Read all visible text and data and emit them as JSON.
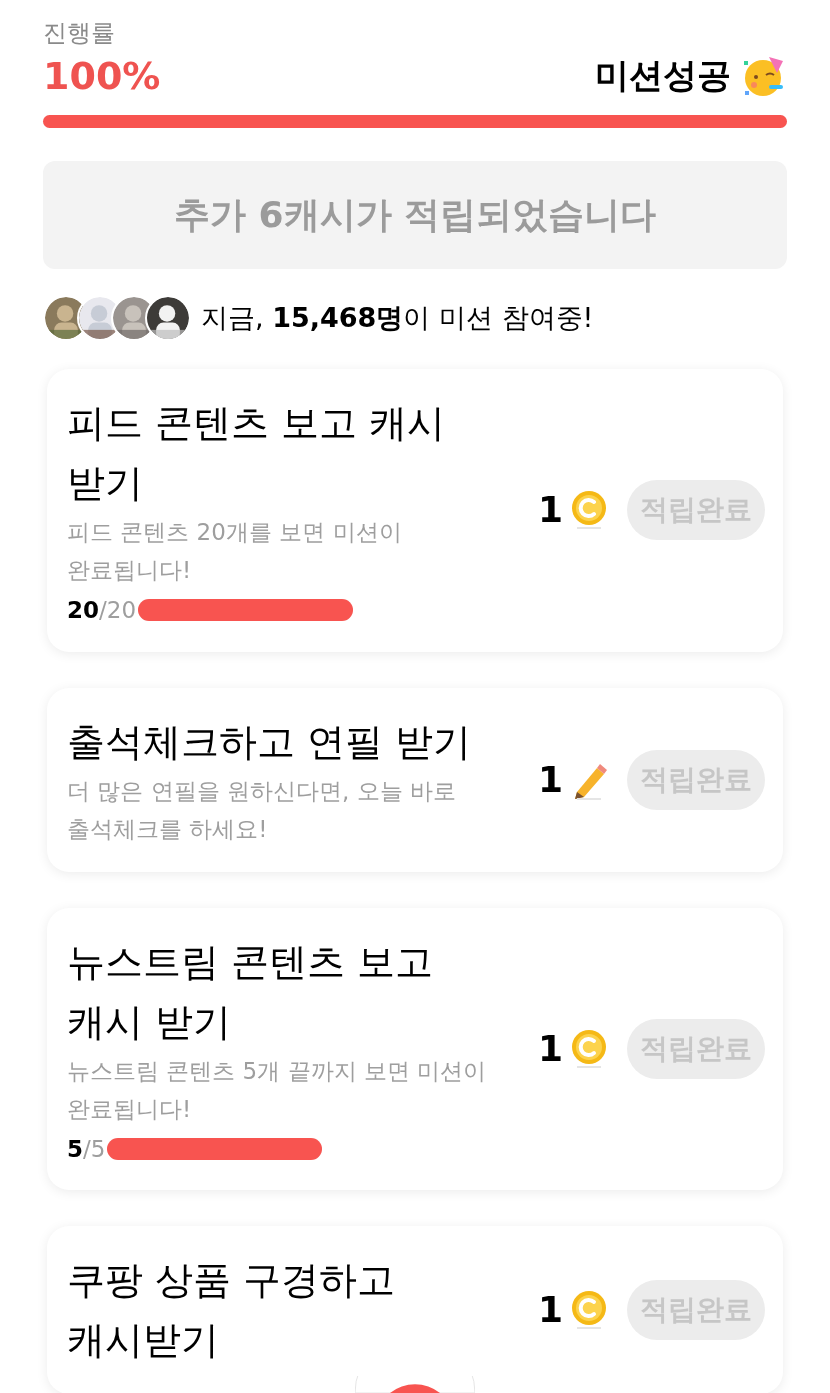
{
  "progress": {
    "label": "진행률",
    "percent": "100%",
    "status": "미션성공",
    "level": 1
  },
  "notice": "추가 6캐시가 적립되었습니다",
  "participants": {
    "text": "지금, **15,468명**이 미션 참여중!"
  },
  "missions": [
    {
      "title": "피드 콘텐츠 보고 캐시 받기",
      "description": "피드 콘텐츠 20개를 보면 미션이 완료됩니다!",
      "progress": {
        "current": "20",
        "total": "/20",
        "level": 1
      },
      "reward": {
        "amount": "1",
        "kind": "coin"
      },
      "button": "적립완료",
      "disabled": true
    },
    {
      "title": "출석체크하고 연필 받기",
      "description": "더 많은 연필을 원하신다면, 오늘 바로 출석체크를 하세요!",
      "reward": {
        "amount": "1",
        "kind": "pencil"
      },
      "button": "적립완료",
      "disabled": true
    },
    {
      "title": "뉴스트림 콘텐츠 보고 캐시 받기",
      "description": "뉴스트림 콘텐츠 5개 끝까지 보면 미션이 완료됩니다!",
      "progress": {
        "current": "5",
        "total": "/5",
        "level": 1
      },
      "reward": {
        "amount": "1",
        "kind": "coin"
      },
      "button": "적립완료",
      "disabled": true
    },
    {
      "title": "쿠팡 상품 구경하고 캐시받기",
      "reward": {
        "amount": "1",
        "kind": "coin"
      },
      "button": "적립완료",
      "disabled": true
    }
  ]
}
